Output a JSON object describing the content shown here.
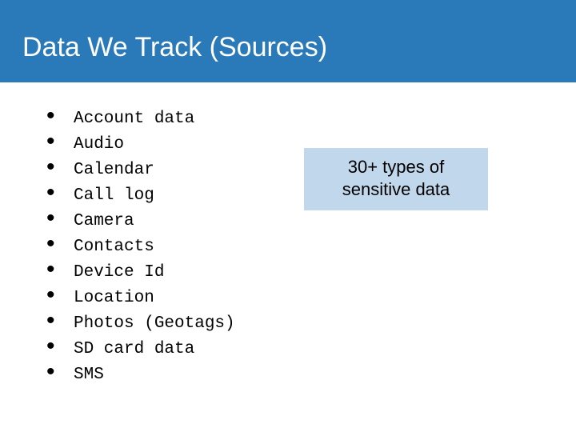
{
  "header": {
    "title": "Data We Track (Sources)"
  },
  "list": {
    "items": [
      "Account data",
      "Audio",
      "Calendar",
      "Call log",
      "Camera",
      "Contacts",
      "Device Id",
      "Location",
      "Photos (Geotags)",
      "SD card data",
      "SMS"
    ]
  },
  "callout": {
    "line1": "30+ types of",
    "line2": "sensitive data"
  }
}
